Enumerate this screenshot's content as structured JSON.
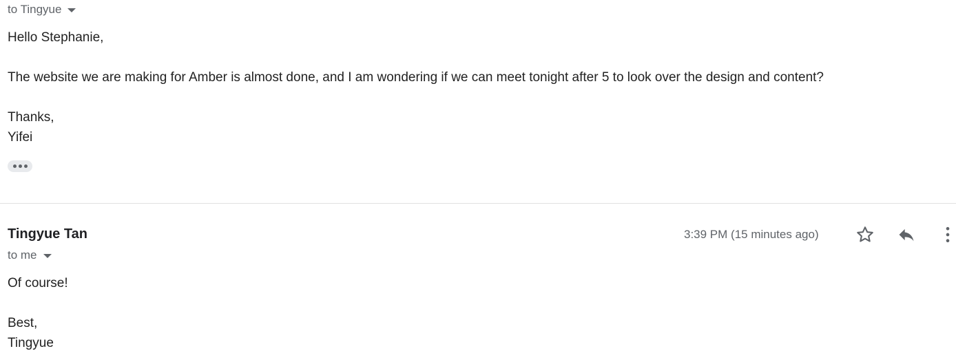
{
  "message_one": {
    "recipient_text": "to Tingyue",
    "body_lines": [
      "Hello Stephanie,",
      "The website we are making for Amber is almost done, and I am wondering if we can meet tonight after 5 to look over the design and content?",
      "Thanks,",
      "Yifei"
    ],
    "show_trimmed_icon": "more-horiz-icon"
  },
  "message_two": {
    "sender_name": "Tingyue Tan",
    "recipient_text": "to me",
    "timestamp": "3:39 PM (15 minutes ago)",
    "body_lines": [
      "Of course!",
      "Best,",
      "Tingyue"
    ],
    "actions": {
      "star_icon": "star-outline-icon",
      "reply_icon": "reply-icon",
      "more_icon": "more-vert-icon"
    }
  },
  "colors": {
    "text_primary": "#222222",
    "text_secondary": "#5f6368",
    "divider": "#e0e0e0",
    "chip_bg": "#e8eaed"
  }
}
